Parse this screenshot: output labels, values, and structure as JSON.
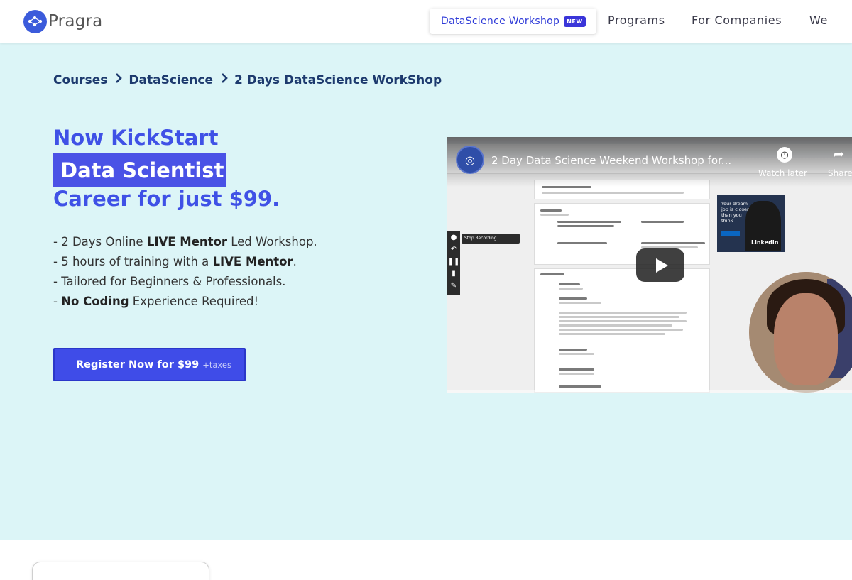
{
  "nav": {
    "logo_text": "Pragra",
    "workshop_pill": {
      "label": "DataScience Workshop",
      "badge": "NEW"
    },
    "links": [
      "Programs",
      "For Companies",
      "We"
    ]
  },
  "breadcrumb": [
    "Courses",
    "DataScience",
    "2 Days DataScience WorkShop"
  ],
  "hero": {
    "line1": "Now KickStart",
    "highlight": "Data Scientist",
    "line3": "Career for just $99.",
    "bullets": [
      {
        "pre": "- 2 Days Online ",
        "bold": "LIVE Mentor",
        "post": " Led Workshop."
      },
      {
        "pre": "- 5 hours of training with a ",
        "bold": "LIVE Mentor",
        "post": "."
      },
      {
        "pre": "- Tailored for Beginners & Professionals.",
        "bold": "",
        "post": ""
      },
      {
        "pre": "- ",
        "bold": "No Coding",
        "post": " Experience Required!"
      }
    ],
    "cta": {
      "label": "Register Now for $99",
      "suffix": "+taxes"
    }
  },
  "video": {
    "title": "2 Day Data Science Weekend Workshop for...",
    "watch_later": "Watch later",
    "share": "Share",
    "stop_recording": "Stop Recording",
    "ad_text": "Your dream job is closer than you think",
    "ad_brand": "LinkedIn",
    "icons": [
      "channel-avatar-icon",
      "clock-icon",
      "share-icon",
      "play-icon"
    ]
  },
  "colors": {
    "accent": "#3f51e6",
    "hero_bg": "#dcf5f7",
    "breadcrumb": "#1d3a6e"
  }
}
